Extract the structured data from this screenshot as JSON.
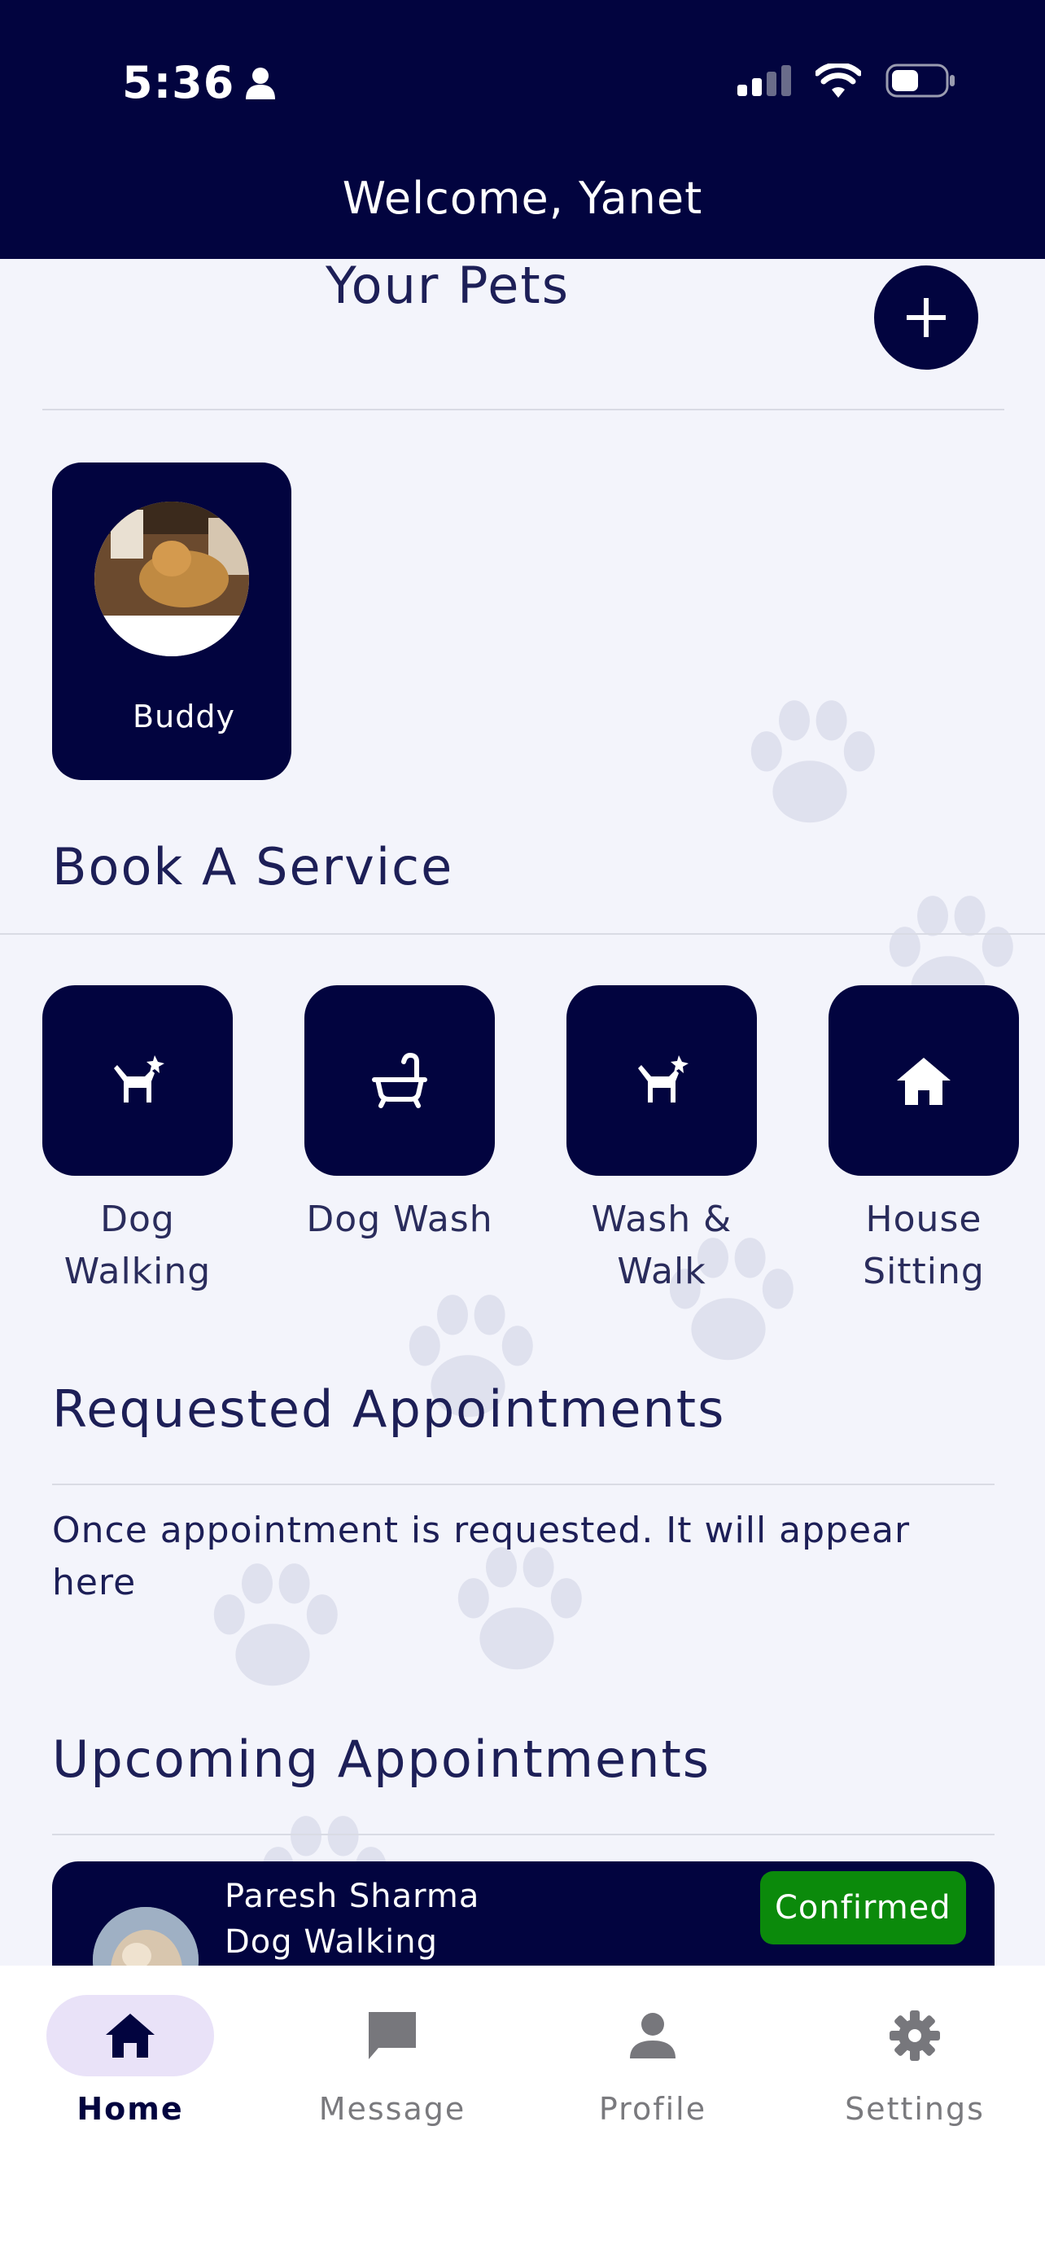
{
  "status_bar": {
    "time": "5:36"
  },
  "header": {
    "welcome": "Welcome, Yanet"
  },
  "pets_section": {
    "title": "Your Pets",
    "pets": [
      {
        "name": "Buddy"
      }
    ]
  },
  "services_section": {
    "title": "Book A Service",
    "items": [
      {
        "label": "Dog\nWalking",
        "icon": "dog-icon"
      },
      {
        "label": "Dog Wash",
        "icon": "bathtub-icon"
      },
      {
        "label": "Wash &\nWalk",
        "icon": "dog-icon"
      },
      {
        "label": "House\nSitting",
        "icon": "house-icon"
      }
    ]
  },
  "requested_section": {
    "title": "Requested Appointments",
    "empty_text": "Once appointment is requested. It will appear here"
  },
  "upcoming_section": {
    "title": "Upcoming Appointments",
    "appointments": [
      {
        "name": "Paresh Sharma",
        "service": "Dog Walking",
        "status": "Confirmed",
        "status_color": "#0b8a0b"
      }
    ]
  },
  "nav": {
    "items": [
      {
        "label": "Home",
        "icon": "home-icon",
        "active": true
      },
      {
        "label": "Message",
        "icon": "message-icon",
        "active": false
      },
      {
        "label": "Profile",
        "icon": "profile-icon",
        "active": false
      },
      {
        "label": "Settings",
        "icon": "gear-icon",
        "active": false
      }
    ]
  },
  "colors": {
    "primary": "#02043f",
    "background": "#f3f4fb",
    "nav_active_pill": "#e9e2f8"
  }
}
